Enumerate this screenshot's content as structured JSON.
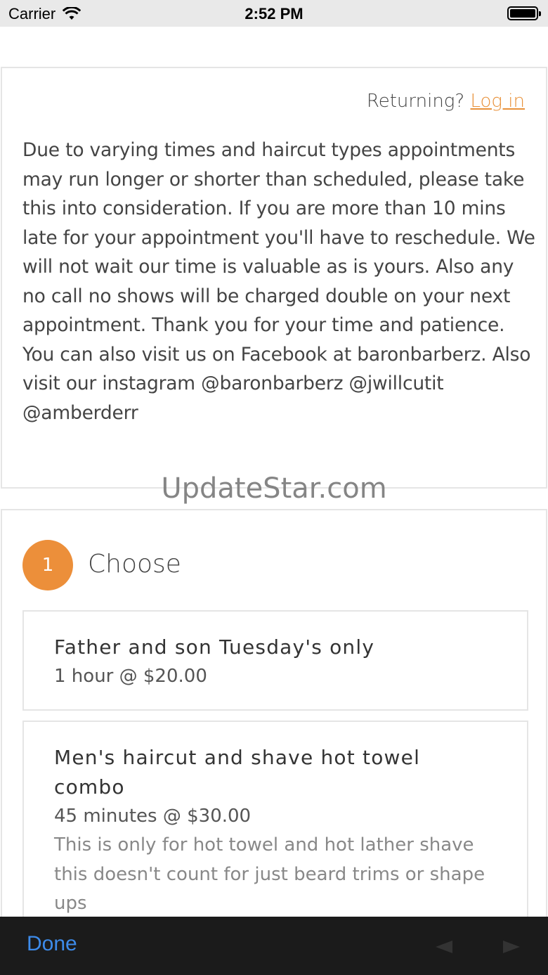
{
  "status_bar": {
    "carrier": "Carrier",
    "time": "2:52 PM"
  },
  "info": {
    "returning_label": "Returning?",
    "login_link": "Log in",
    "notice": "Due to varying times and haircut types appointments may run longer or shorter than scheduled, please take this into consideration. If you are more than 10 mins late for your appointment you'll have to reschedule. We will not wait our time is valuable as is yours. Also any no call no shows will be charged double on your next appointment. Thank you for your time and patience. You can also visit us on Facebook at baronbarberz. Also visit our instagram @baronbarberz @jwillcutit @amberderr"
  },
  "watermark": "UpdateStar.com",
  "choose": {
    "step_number": "1",
    "title": "Choose",
    "services": [
      {
        "name": "Father and son Tuesday's only",
        "meta": "1 hour @ $20.00",
        "description": ""
      },
      {
        "name": "Men's haircut and shave hot towel combo",
        "meta": "45 minutes @ $30.00",
        "description": "This is only for hot towel and hot lather shave this doesn't count for just beard trims or shape ups"
      }
    ]
  },
  "keyboard_bar": {
    "done_label": "Done"
  },
  "colors": {
    "accent": "#ec8f3a",
    "link": "#e8913a",
    "done": "#3d8bea"
  }
}
